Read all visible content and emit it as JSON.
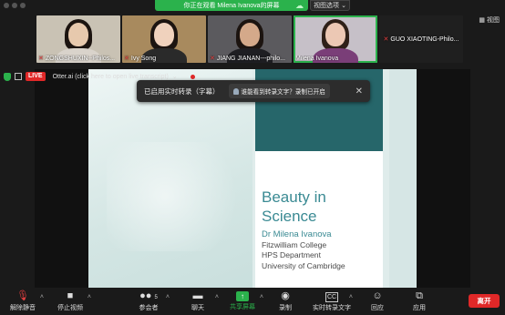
{
  "banner": {
    "sharing_text": "你正在观看 Milena Ivanova的屏幕",
    "view_options": "视图选项"
  },
  "view_button": "视图",
  "participants": [
    {
      "name": "ZONGSHUXIN--Philos...",
      "muted": true
    },
    {
      "name": "Ivy Song",
      "muted": true
    },
    {
      "name": "JIANG JIANAN---philo...",
      "muted": true
    },
    {
      "name": "Milena Ivanova",
      "muted": false
    },
    {
      "name": "GUO XIAOTING-Philo...",
      "muted": true
    }
  ],
  "status": {
    "live": "LIVE",
    "otter": "Otter.ai (click here to open live transcript)"
  },
  "caption_popup": {
    "text": "已启用实时转录（字幕）",
    "inner": "谁能看到转录文字？录制已开启"
  },
  "slide": {
    "title_line1": "Beauty in",
    "title_line2": "Science",
    "author": "Dr Milena Ivanova",
    "college": "Fitzwilliam College",
    "dept": "HPS Department",
    "univ": "University of Cambridge"
  },
  "toolbar": {
    "mute": "解除静音",
    "video": "停止视频",
    "participants": "参会者",
    "participant_count": "5",
    "chat": "聊天",
    "share": "共享屏幕",
    "record": "录制",
    "transcript": "实时转录文字",
    "reactions": "回应",
    "apps": "应用",
    "leave": "离开"
  },
  "colors": {
    "accent": "#2bb24c",
    "danger": "#e02828",
    "slide_teal": "#26666a",
    "title_teal": "#3a8a93"
  }
}
